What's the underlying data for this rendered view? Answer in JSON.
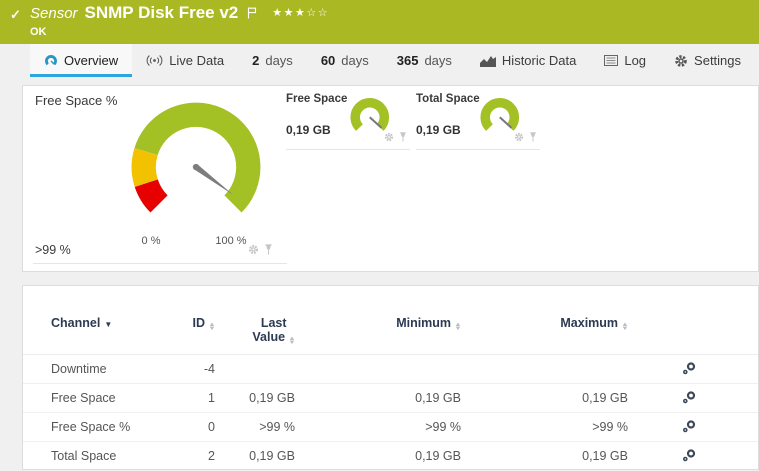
{
  "colors": {
    "accent_blue": "#2da5dd",
    "ok_green": "#aab923",
    "gauge_green": "#a3c024",
    "gauge_yellow": "#f2c100",
    "gauge_red": "#e60000",
    "needle_gray": "#7d7d7d"
  },
  "icons": {
    "check": "✓",
    "stars_filled": "★★★",
    "stars_empty": "☆☆",
    "sort_asc": "▲",
    "sort_desc": "▼",
    "channel_caret": "▼"
  },
  "header": {
    "kind": "Sensor",
    "title": "SNMP Disk Free v2",
    "status": "OK"
  },
  "tabs": {
    "overview": "Overview",
    "live_data": "Live Data",
    "d2_num": "2",
    "d2_label": "days",
    "d60_num": "60",
    "d60_label": "days",
    "d365_num": "365",
    "d365_label": "days",
    "historic": "Historic Data",
    "log": "Log",
    "settings": "Settings"
  },
  "gauges": {
    "primary": {
      "title": "Free Space %",
      "value": ">99 %",
      "min_label": "0 %",
      "max_label": "100 %"
    },
    "free": {
      "title": "Free Space",
      "value": "0,19 GB"
    },
    "total": {
      "title": "Total Space",
      "value": "0,19 GB"
    }
  },
  "table": {
    "headers": {
      "channel": "Channel",
      "id": "ID",
      "last1": "Last",
      "last2": "Value",
      "min": "Minimum",
      "max": "Maximum"
    },
    "rows": [
      {
        "channel": "Downtime",
        "id": "-4",
        "last": "",
        "min": "",
        "max": ""
      },
      {
        "channel": "Free Space",
        "id": "1",
        "last": "0,19 GB",
        "min": "0,19 GB",
        "max": "0,19 GB"
      },
      {
        "channel": "Free Space %",
        "id": "0",
        "last": ">99 %",
        "min": ">99 %",
        "max": ">99 %"
      },
      {
        "channel": "Total Space",
        "id": "2",
        "last": "0,19 GB",
        "min": "0,19 GB",
        "max": "0,19 GB"
      }
    ]
  }
}
